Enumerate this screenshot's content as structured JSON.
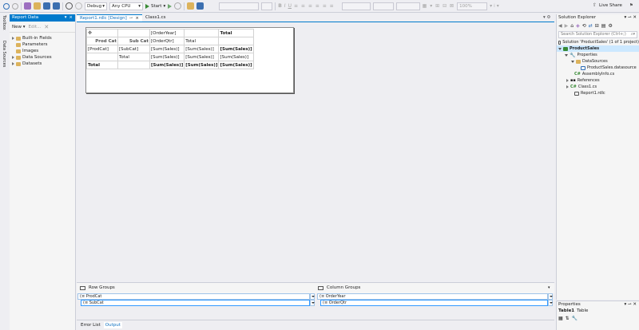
{
  "toolbar": {
    "config": "Debug",
    "platform": "Any CPU",
    "start_label": "Start",
    "zoom": "100%",
    "live_share": "Live Share"
  },
  "side_tabs": {
    "toolbox": "Toolbox",
    "data_sources": "Data Sources"
  },
  "report_data": {
    "title": "Report Data",
    "pin": "▾  ⨯",
    "new_label": "New",
    "edit_label": "Edit...",
    "tree": [
      "Built-in Fields",
      "Parameters",
      "Images",
      "Data Sources",
      "Datasets"
    ]
  },
  "doc_tabs": {
    "tab1": "Report1.rdlc [Design]",
    "tab2": "Class1.cs",
    "close": "⨯",
    "pin": "▾ ⚙"
  },
  "tablix": {
    "header_row1": {
      "c3": "[OrderYear]",
      "c5": "Total"
    },
    "header_row2": {
      "c1": "Prod Cat",
      "c2": "Sub Cat",
      "c3": "[OrderQtr]",
      "c4": "Total"
    },
    "row3": {
      "c1": "[ProdCat]",
      "c2": "[SubCat]",
      "c3": "[Sum(Sales)]",
      "c4": "[Sum(Sales)]",
      "c5": "[Sum(Sales)]"
    },
    "row4": {
      "c2": "Total",
      "c3": "[Sum(Sales)]",
      "c4": "[Sum(Sales)]",
      "c5": "[Sum(Sales)]"
    },
    "row5": {
      "c1": "Total",
      "c3": "[Sum(Sales)]",
      "c4": "[Sum(Sales)]",
      "c5": "[Sum(Sales)]"
    }
  },
  "groups": {
    "row_groups_title": "Row Groups",
    "column_groups_title": "Column Groups",
    "row_groups": [
      "(≡ ProdCat",
      "(≡ SubCat"
    ],
    "column_groups": [
      "(≡ OrderYear",
      "(≡ OrderQtr"
    ]
  },
  "bottom_tabs": [
    "Error List",
    "Output"
  ],
  "solution_explorer": {
    "title": "Solution Explorer",
    "search_placeholder": "Search Solution Explorer (Ctrl+;)",
    "items": [
      "Solution 'ProductSales' (1 of 1 project)",
      "ProductSales",
      "Properties",
      "DataSources",
      "ProductSales.datasource",
      "AssemblyInfo.cs",
      "References",
      "Class1.cs",
      "Report1.rdlc"
    ]
  },
  "properties": {
    "title": "Properties",
    "object": "Table1",
    "object_type": "Table"
  }
}
